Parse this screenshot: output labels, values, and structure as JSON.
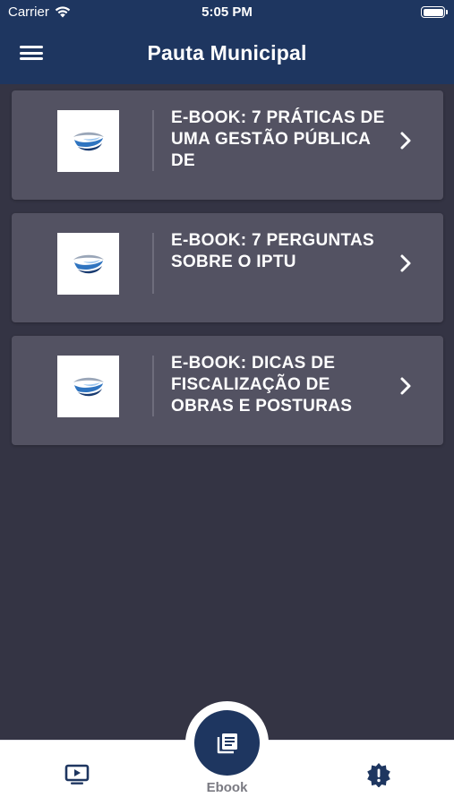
{
  "status_bar": {
    "carrier": "Carrier",
    "time": "5:05 PM"
  },
  "header": {
    "title": "Pauta Municipal"
  },
  "items": [
    {
      "title": "E-BOOK: 7 PRÁTICAS DE UMA GESTÃO PÚBLICA DE"
    },
    {
      "title": "E-BOOK: 7 PERGUNTAS SOBRE O IPTU"
    },
    {
      "title": "E-BOOK: DICAS DE FISCALIZAÇÃO DE OBRAS E POSTURAS"
    }
  ],
  "tabbar": {
    "center_label": "Ebook"
  },
  "colors": {
    "navy": "#1e3660",
    "background": "#343444",
    "card": "#535262"
  },
  "icons": [
    "menu-icon",
    "wifi-icon",
    "battery-icon",
    "logo-icon",
    "chevron-right-icon",
    "video-icon",
    "book-icon",
    "alert-icon"
  ]
}
